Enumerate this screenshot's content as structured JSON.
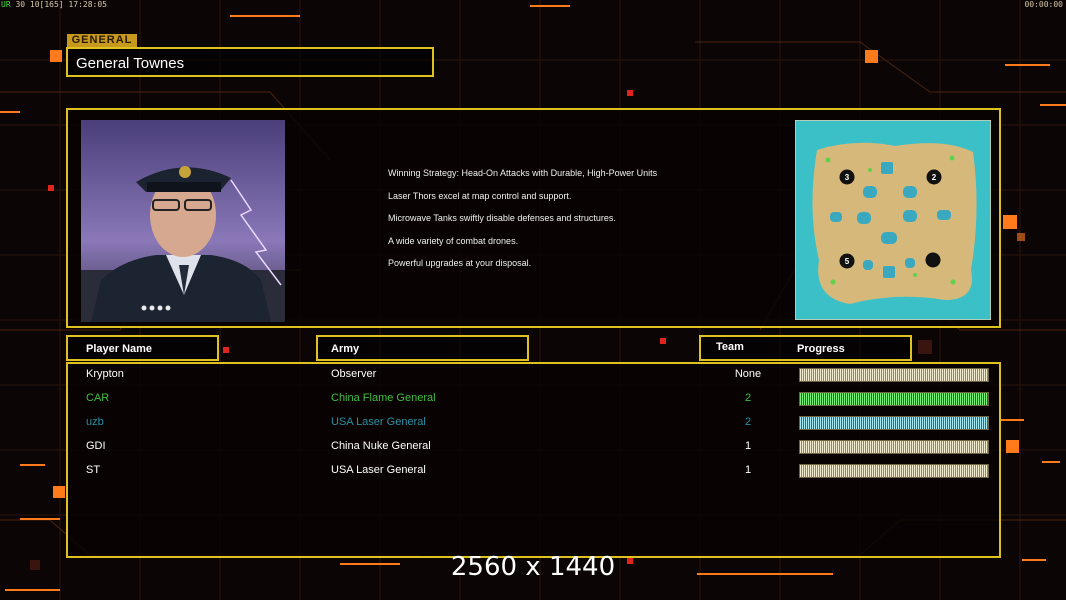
{
  "hud": {
    "left_prefix": "UR",
    "left_rest": "30 10[165] 17:28:05",
    "right": "00:00:00"
  },
  "general": {
    "tag": "GENERAL",
    "name": "General Townes"
  },
  "strategy_lines": [
    "Winning Strategy: Head-On Attacks with Durable, High-Power Units",
    "Laser Thors excel at map control and support.",
    "Microwave Tanks swiftly disable defenses and structures.",
    "A wide variety of combat drones.",
    "Powerful upgrades at your disposal."
  ],
  "map": {
    "start_positions": [
      "3",
      "2",
      "5"
    ]
  },
  "table": {
    "headers": {
      "player_name": "Player Name",
      "army": "Army",
      "team": "Team",
      "progress": "Progress"
    },
    "rows": [
      {
        "name": "Krypton",
        "army": "Observer",
        "team": "None",
        "color": "#ffffff",
        "progress": 1.0
      },
      {
        "name": "CAR",
        "army": "China Flame General",
        "team": "2",
        "color": "#3fbf3f",
        "progress": 1.0
      },
      {
        "name": "uzb",
        "army": "USA Laser General",
        "team": "2",
        "color": "#2b8fa6",
        "progress": 1.0
      },
      {
        "name": "GDI",
        "army": "China Nuke General",
        "team": "1",
        "color": "#ffffff",
        "progress": 1.0
      },
      {
        "name": "ST",
        "army": "USA Laser General",
        "team": "1",
        "color": "#ffffff",
        "progress": 1.0
      }
    ]
  },
  "resolution_text": "2560 x 1440",
  "colors": {
    "frame": "#dfc21f",
    "accent_orange": "#ff7a1a",
    "background": "#0b0605"
  }
}
